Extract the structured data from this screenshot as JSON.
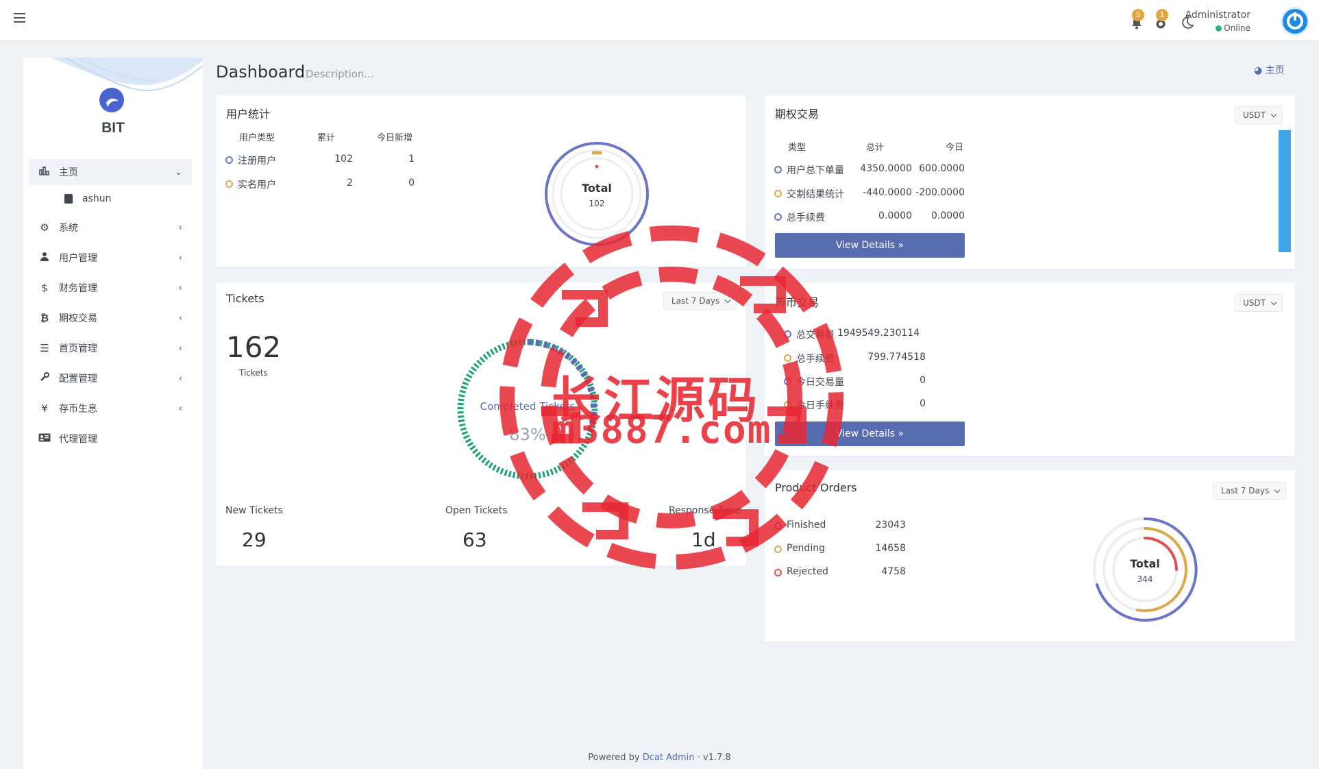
{
  "topbar": {
    "notifications_count": "5",
    "messages_count": "1",
    "user_name": "Administrator",
    "user_status": "Online"
  },
  "sidebar": {
    "brand": "BIT",
    "items": [
      {
        "label": "主页",
        "icon": "bar-chart-icon"
      },
      {
        "label": "ashun",
        "icon": "file-icon"
      },
      {
        "label": "系统",
        "icon": "gear-icon"
      },
      {
        "label": "用户管理",
        "icon": "users-icon"
      },
      {
        "label": "财务管理",
        "icon": "dollar-icon"
      },
      {
        "label": "期权交易",
        "icon": "bitcoin-icon"
      },
      {
        "label": "首页管理",
        "icon": "list-icon"
      },
      {
        "label": "配置管理",
        "icon": "wrench-icon"
      },
      {
        "label": "存币生息",
        "icon": "yen-icon"
      },
      {
        "label": "代理管理",
        "icon": "id-card-icon"
      }
    ]
  },
  "header": {
    "title": "Dashboard",
    "description": "Description...",
    "breadcrumb": "主页"
  },
  "user_stats": {
    "title": "用户统计",
    "columns": [
      "用户类型",
      "累计",
      "今日新增"
    ],
    "rows": [
      {
        "type": "注册用户",
        "total": "102",
        "today": "1"
      },
      {
        "type": "实名用户",
        "total": "2",
        "today": "0"
      }
    ],
    "donut_label": "Total",
    "donut_value": "102"
  },
  "options_trade": {
    "title": "期权交易",
    "currency": "USDT",
    "columns": [
      "类型",
      "总计",
      "今日"
    ],
    "rows": [
      {
        "type": "用户总下单量",
        "total": "4350.0000",
        "today": "600.0000"
      },
      {
        "type": "交割结果统计",
        "total": "-440.0000",
        "today": "-200.0000"
      },
      {
        "type": "总手续费",
        "total": "0.0000",
        "today": "0.0000"
      }
    ],
    "button": "View Details »"
  },
  "tickets": {
    "title": "Tickets",
    "range": "Last 7 Days",
    "count": "162",
    "count_label": "Tickets",
    "gauge_label": "Completed Tickets",
    "gauge_value": "83%",
    "stats": [
      {
        "label": "New Tickets",
        "value": "29"
      },
      {
        "label": "Open Tickets",
        "value": "63"
      },
      {
        "label": "Response Time",
        "value": "1d"
      }
    ]
  },
  "coin_trade": {
    "title": "币币交易",
    "currency": "USDT",
    "rows": [
      {
        "label": "总交易量",
        "value": "1949549.230114"
      },
      {
        "label": "总手续费",
        "value": "799.774518"
      },
      {
        "label": "今日交易量",
        "value": "0"
      },
      {
        "label": "今日手续费",
        "value": "0"
      }
    ],
    "button": "View Details »"
  },
  "product_orders": {
    "title": "Product Orders",
    "range": "Last 7 Days",
    "rows": [
      {
        "label": "Finished",
        "value": "23043"
      },
      {
        "label": "Pending",
        "value": "14658"
      },
      {
        "label": "Rejected",
        "value": "4758"
      }
    ],
    "donut_label": "Total",
    "donut_value": "344"
  },
  "footer": {
    "prefix": "Powered by",
    "link": "Dcat Admin",
    "version": "v1.7.8"
  },
  "watermark": {
    "line1": "长江源码",
    "line2": "m3887.com"
  },
  "colors": {
    "primary": "#586cb1",
    "blue_ring": "#6a75c8",
    "orange": "#dda84d",
    "red": "#e0504f",
    "green": "#21b978",
    "watermark_red": "#e62832"
  }
}
